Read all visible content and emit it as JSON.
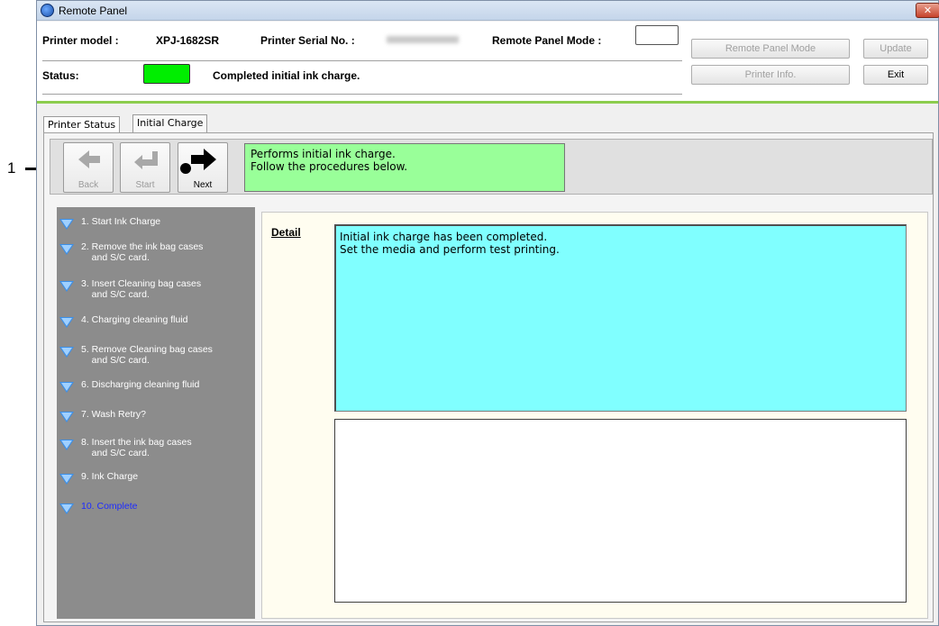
{
  "window": {
    "title": "Remote Panel",
    "close_label": "✕"
  },
  "header": {
    "printer_model_label": "Printer model :",
    "printer_model_value": "XPJ-1682SR",
    "serial_label": "Printer Serial No. :",
    "mode_label": "Remote Panel Mode :",
    "status_label": "Status:",
    "status_text": "Completed initial ink charge.",
    "status_color": "#00ee00",
    "buttons": {
      "remote_panel_mode": "Remote Panel Mode",
      "update": "Update",
      "printer_info": "Printer Info.",
      "exit": "Exit"
    }
  },
  "tabs": [
    {
      "label": "Printer Status",
      "active": false
    },
    {
      "label": "Initial Charge",
      "active": true
    }
  ],
  "nav": {
    "back": "Back",
    "start": "Start",
    "next": "Next",
    "info_lines": [
      "Performs initial ink charge.",
      "Follow the procedures below."
    ]
  },
  "steps": [
    {
      "label": "1. Start Ink Charge"
    },
    {
      "label": "2. Remove the ink bag cases\n    and S/C card."
    },
    {
      "label": "3. Insert Cleaning bag cases\n    and S/C card."
    },
    {
      "label": "4. Charging cleaning fluid"
    },
    {
      "label": "5. Remove Cleaning bag cases\n    and S/C card."
    },
    {
      "label": "6. Discharging cleaning fluid"
    },
    {
      "label": "7. Wash Retry?"
    },
    {
      "label": "8. Insert the ink bag cases\n    and S/C card."
    },
    {
      "label": "9. Ink Charge"
    },
    {
      "label": "10. Complete",
      "current": true
    }
  ],
  "detail": {
    "label": "Detail",
    "lines": [
      "Initial ink charge has been completed.",
      "Set the media and perform test printing."
    ]
  },
  "callout": {
    "number": "1"
  },
  "colors": {
    "accent_band": "#8ccd4e",
    "info_bg": "#99ff99",
    "detail_bg": "#80ffff",
    "current_step": "#1e2cff"
  }
}
